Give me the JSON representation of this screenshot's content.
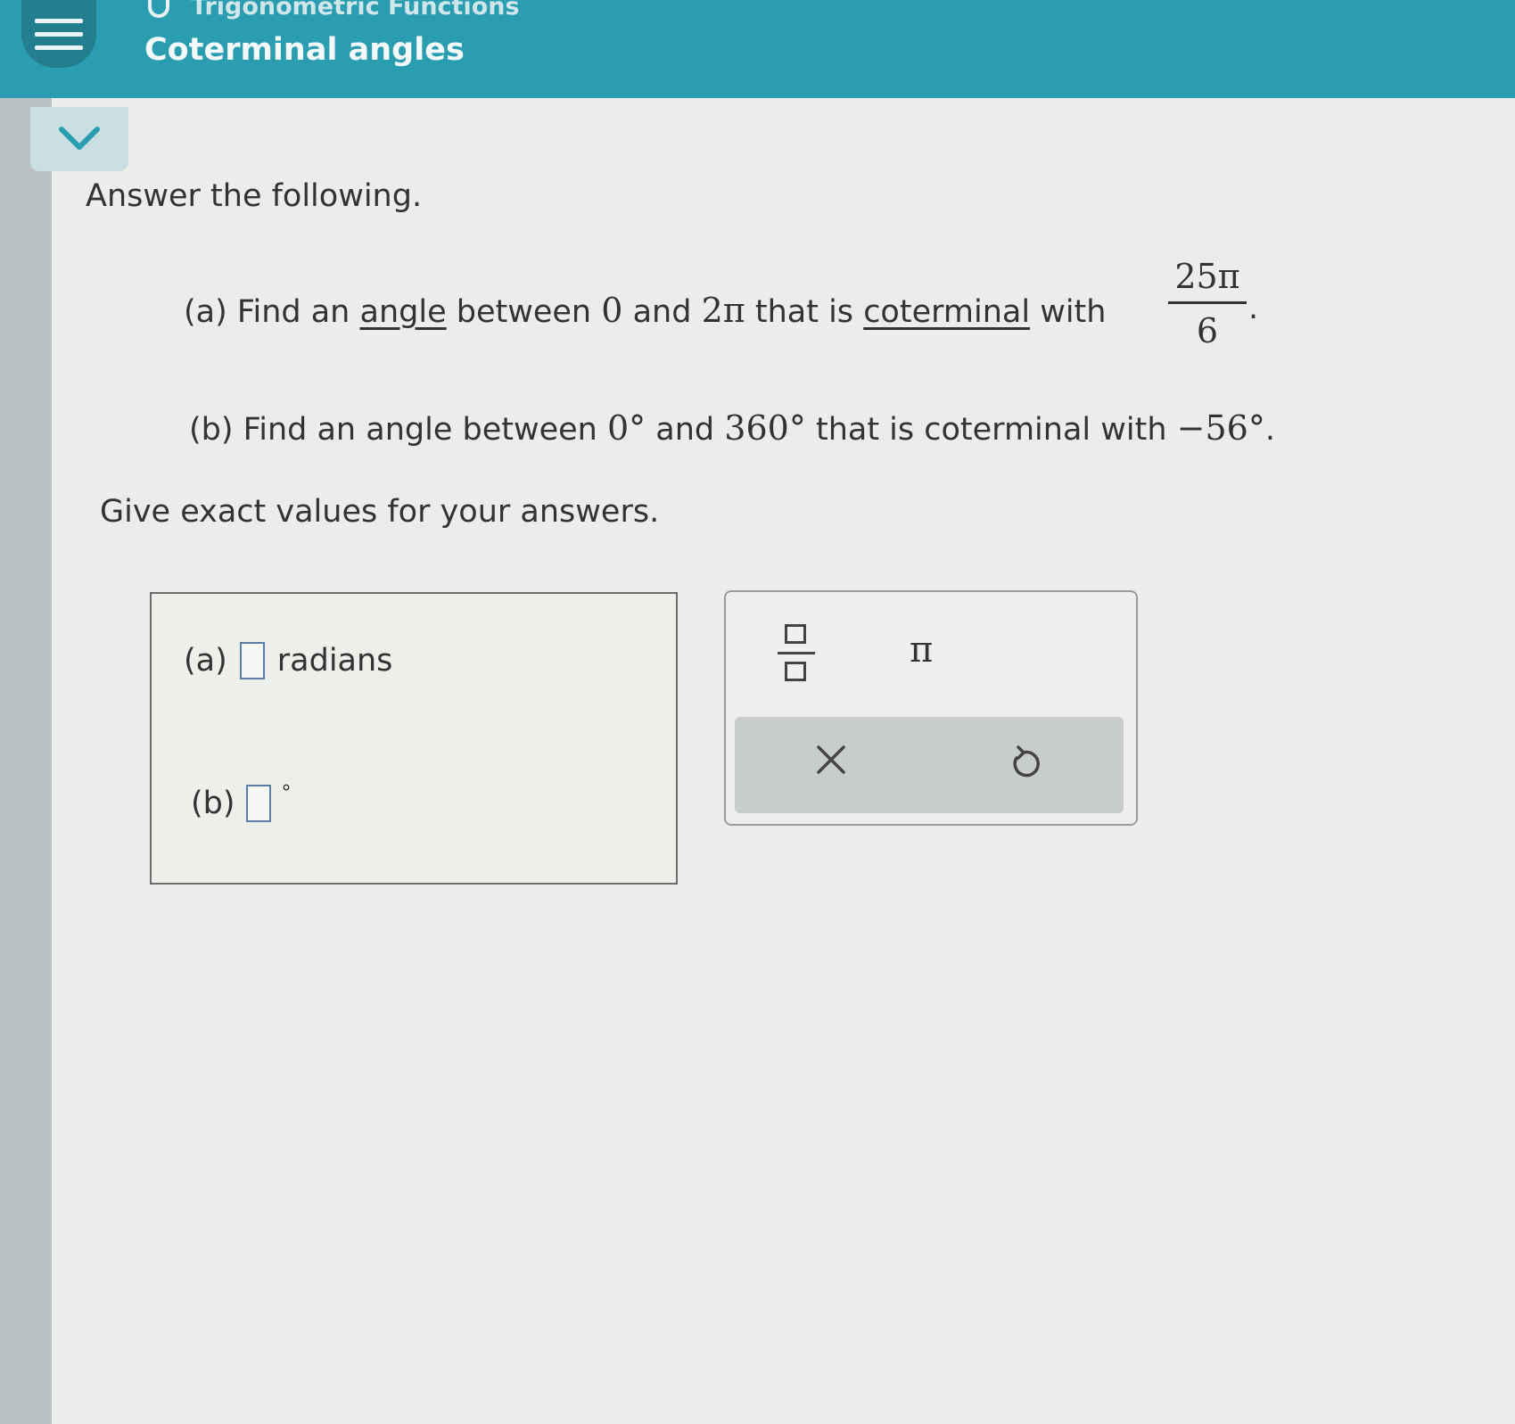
{
  "header": {
    "topic": "Trigonometric Functions",
    "title": "Coterminal angles"
  },
  "question": {
    "intro": "Answer the following.",
    "part_a": {
      "label": "(a) Find an",
      "angle_link": "angle",
      "between": "between",
      "low": "0",
      "and": "and",
      "high": "2π",
      "that_is": "that is",
      "coterminal_link": "coterminal",
      "with": "with",
      "fraction_numerator": "25π",
      "fraction_denominator": "6",
      "end": "."
    },
    "part_b": {
      "label": "(b) Find an angle between",
      "low": "0°",
      "and": "and",
      "high": "360°",
      "rest": "that is coterminal with",
      "value": "−56°",
      "end": "."
    },
    "note": "Give exact values for your answers."
  },
  "answers": {
    "a_label": "(a)",
    "a_unit": "radians",
    "b_label": "(b)",
    "b_unit": "°"
  },
  "keypad": {
    "fraction_key": "fraction-icon",
    "pi_key": "π",
    "clear_key": "clear-icon",
    "undo_key": "undo-icon"
  },
  "colors": {
    "header": "#2a9db1",
    "menu_button": "#237f90",
    "input_border": "#5b7ea8"
  }
}
